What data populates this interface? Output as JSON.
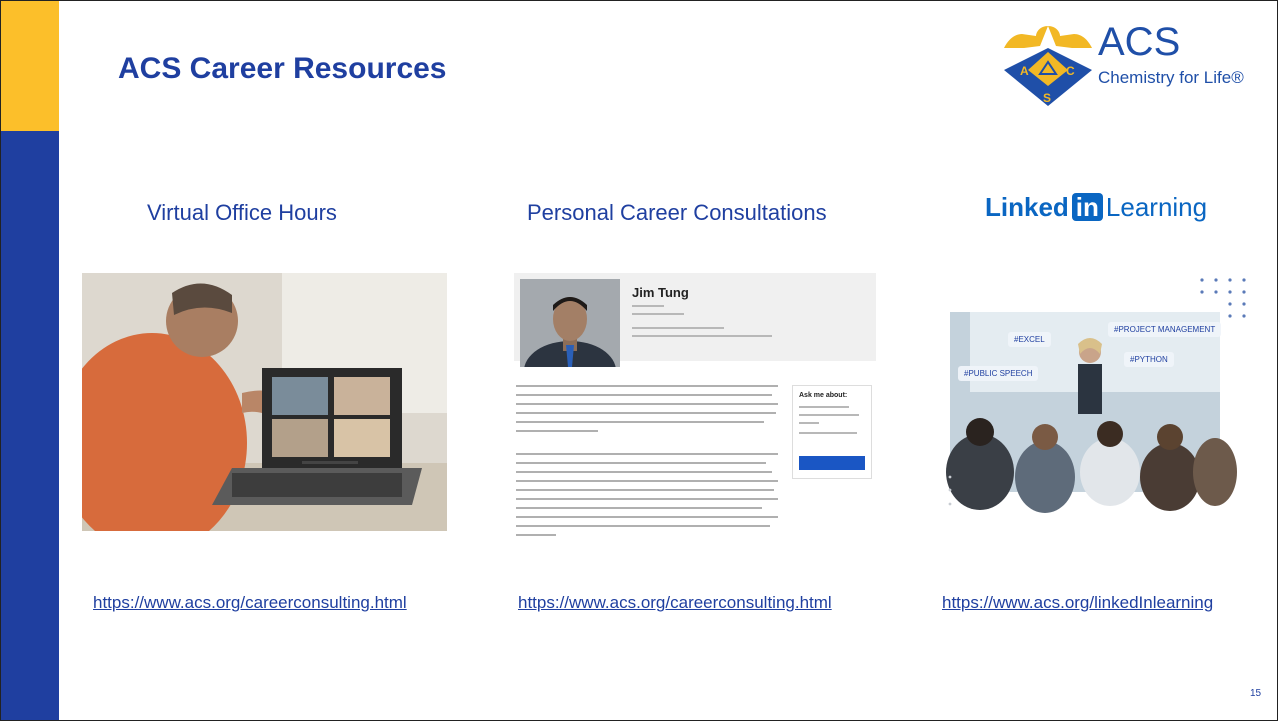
{
  "slide": {
    "title": "ACS Career Resources",
    "page_number": "15"
  },
  "logo": {
    "name": "ACS",
    "tagline": "Chemistry for Life®",
    "seal_letters": [
      "A",
      "C",
      "S"
    ]
  },
  "columns": [
    {
      "title": "Virtual Office Hours",
      "image": "video-call-photo",
      "link": "https://www.acs.org/careerconsulting.html"
    },
    {
      "title": "Personal Career Consultations",
      "image": "consultant-profile",
      "link": "https://www.acs.org/careerconsulting.html"
    },
    {
      "title_brand": [
        "Linked",
        "in",
        "Learning"
      ],
      "image": "classroom-photo",
      "link": "https://www.acs.org/linkedInlearning"
    }
  ],
  "profile": {
    "name": "Jim Tung",
    "ask_title": "Ask me about:"
  },
  "tags": [
    "#EXCEL",
    "#PROJECT MANAGEMENT",
    "#PYTHON",
    "#PUBLIC SPEECH"
  ],
  "colors": {
    "brand_blue": "#1f3fa0",
    "accent_gold": "#fcbf2a",
    "linkedin_blue": "#0a66c2"
  }
}
